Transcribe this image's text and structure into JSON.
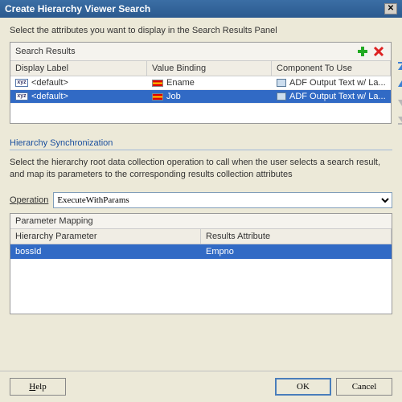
{
  "title": "Create Hierarchy Viewer Search",
  "instruction": "Select the attributes you want to display in the Search Results Panel",
  "searchResults": {
    "header": "Search Results",
    "columns": {
      "c1": "Display Label",
      "c2": "Value Binding",
      "c3": "Component To Use"
    },
    "rows": [
      {
        "label": "<default>",
        "binding": "Ename",
        "component": "ADF Output Text w/ La...",
        "selected": false
      },
      {
        "label": "<default>",
        "binding": "Job",
        "component": "ADF Output Text w/ La...",
        "selected": true
      }
    ]
  },
  "hsync": {
    "title": "Hierarchy Synchronization",
    "instruction": "Select the hierarchy root data collection operation to call when the user selects a search result, and map its parameters to the corresponding results collection attributes",
    "operationLabel": "Operation",
    "operationValue": "ExecuteWithParams"
  },
  "paramMapping": {
    "header": "Parameter Mapping",
    "columns": {
      "c1": "Hierarchy Parameter",
      "c2": "Results Attribute"
    },
    "rows": [
      {
        "param": "bossId",
        "attr": "Empno",
        "selected": true
      }
    ]
  },
  "buttons": {
    "help": "Help",
    "ok": "OK",
    "cancel": "Cancel"
  }
}
